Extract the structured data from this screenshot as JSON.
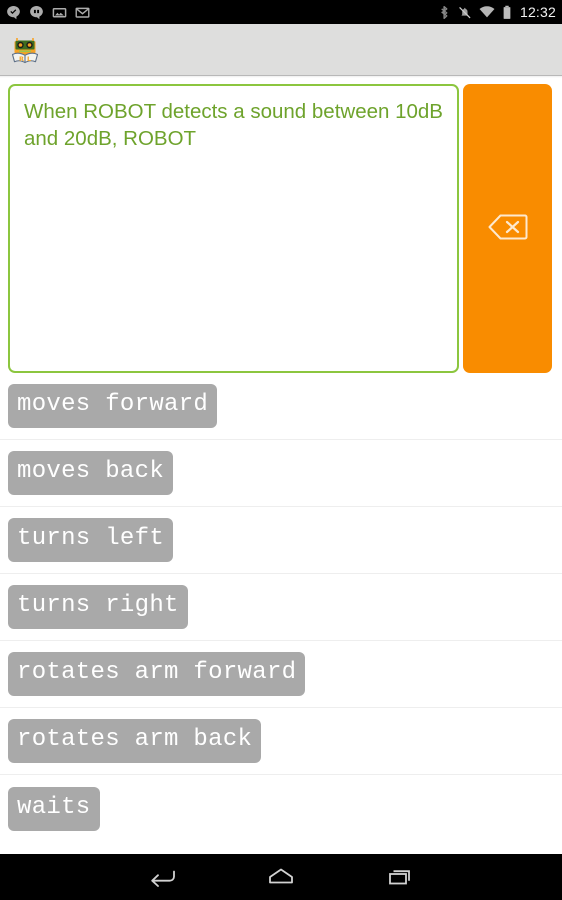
{
  "status_bar": {
    "notifications": [
      {
        "name": "hangouts-check-icon",
        "glyph": "hangouts"
      },
      {
        "name": "hangouts-message-icon",
        "glyph": "hangouts-message"
      },
      {
        "name": "screenshot-image-icon",
        "glyph": "image"
      },
      {
        "name": "gmail-icon",
        "glyph": "envelope"
      }
    ],
    "system": [
      {
        "name": "bluetooth-icon",
        "glyph": "bluetooth"
      },
      {
        "name": "ringer-silent-icon",
        "glyph": "bell-muted"
      },
      {
        "name": "wifi-icon",
        "glyph": "wifi"
      },
      {
        "name": "battery-icon",
        "glyph": "battery-full"
      }
    ],
    "clock": "12:32"
  },
  "action_bar": {
    "app_icon_name": "robot-reading-book-app-icon",
    "title": "",
    "background_color": "#dededd"
  },
  "compose": {
    "sentence": "When ROBOT detects a sound between 10dB and 20dB, ROBOT",
    "sentence_color": "#6ea32c",
    "border_color": "#8cc63f",
    "delete_button": {
      "name": "backspace-delete-button",
      "icon": "backspace-icon",
      "label": "",
      "background_color": "#f98c00"
    }
  },
  "word_list": {
    "chip_color": "#a9a9a9",
    "chip_text_color": "#ffffff",
    "items": [
      {
        "label": "moves forward"
      },
      {
        "label": "moves back"
      },
      {
        "label": "turns left"
      },
      {
        "label": "turns right"
      },
      {
        "label": "rotates arm forward"
      },
      {
        "label": "rotates arm back"
      },
      {
        "label": "waits"
      }
    ]
  },
  "nav_bar": {
    "buttons": [
      {
        "name": "nav-back-button",
        "icon": "back-arrow-icon"
      },
      {
        "name": "nav-home-button",
        "icon": "home-icon"
      },
      {
        "name": "nav-recents-button",
        "icon": "recents-icon"
      }
    ]
  }
}
